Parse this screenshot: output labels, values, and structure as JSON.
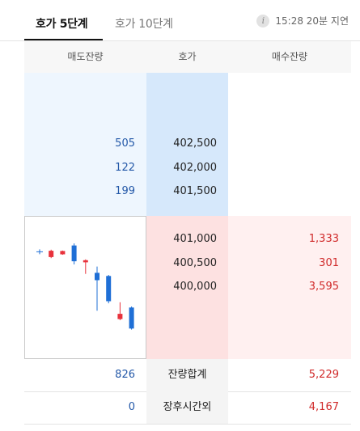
{
  "tabs": [
    {
      "label": "호가 5단계",
      "active": true
    },
    {
      "label": "호가 10단계",
      "active": false
    }
  ],
  "delay_notice": {
    "icon": "info-icon",
    "text": "15:28 20분 지연"
  },
  "columns": {
    "ask_qty": "매도잔량",
    "price": "호가",
    "bid_qty": "매수잔량"
  },
  "asks": [
    {
      "qty": "505",
      "price": "402,500"
    },
    {
      "qty": "122",
      "price": "402,000"
    },
    {
      "qty": "199",
      "price": "401,500"
    }
  ],
  "bids": [
    {
      "price": "401,000",
      "qty": "1,333"
    },
    {
      "price": "400,500",
      "qty": "301"
    },
    {
      "price": "400,000",
      "qty": "3,595"
    }
  ],
  "totals": {
    "ask": "826",
    "label": "잔량합계",
    "bid": "5,229"
  },
  "after_hours": {
    "ask": "0",
    "label": "장후시간외",
    "bid": "4,167"
  },
  "mini_chart": {
    "up_color": "#e8323c",
    "down_color": "#1f6fd6",
    "neutral_color": "#1f6fd6",
    "candles": [
      {
        "dir": "flat",
        "open": 61.0,
        "close": 61.0,
        "high": 61.0,
        "low": 61.0
      },
      {
        "dir": "up",
        "open": 58.5,
        "close": 61.5,
        "high": 62.0,
        "low": 58.0
      },
      {
        "dir": "up",
        "open": 59.8,
        "close": 61.4,
        "high": 61.6,
        "low": 59.6
      },
      {
        "dir": "down",
        "open": 64.0,
        "close": 56.5,
        "high": 65.0,
        "low": 55.0
      },
      {
        "dir": "up",
        "open": 56.0,
        "close": 57.0,
        "high": 57.4,
        "low": 50.5
      },
      {
        "dir": "down",
        "open": 51.0,
        "close": 47.5,
        "high": 54.0,
        "low": 33.0
      },
      {
        "dir": "down",
        "open": 49.5,
        "close": 37.5,
        "high": 50.0,
        "low": 36.5
      },
      {
        "dir": "up",
        "open": 29.0,
        "close": 31.5,
        "high": 37.0,
        "low": 28.5
      },
      {
        "dir": "down",
        "open": 34.5,
        "close": 24.5,
        "high": 35.0,
        "low": 24.0
      }
    ]
  }
}
